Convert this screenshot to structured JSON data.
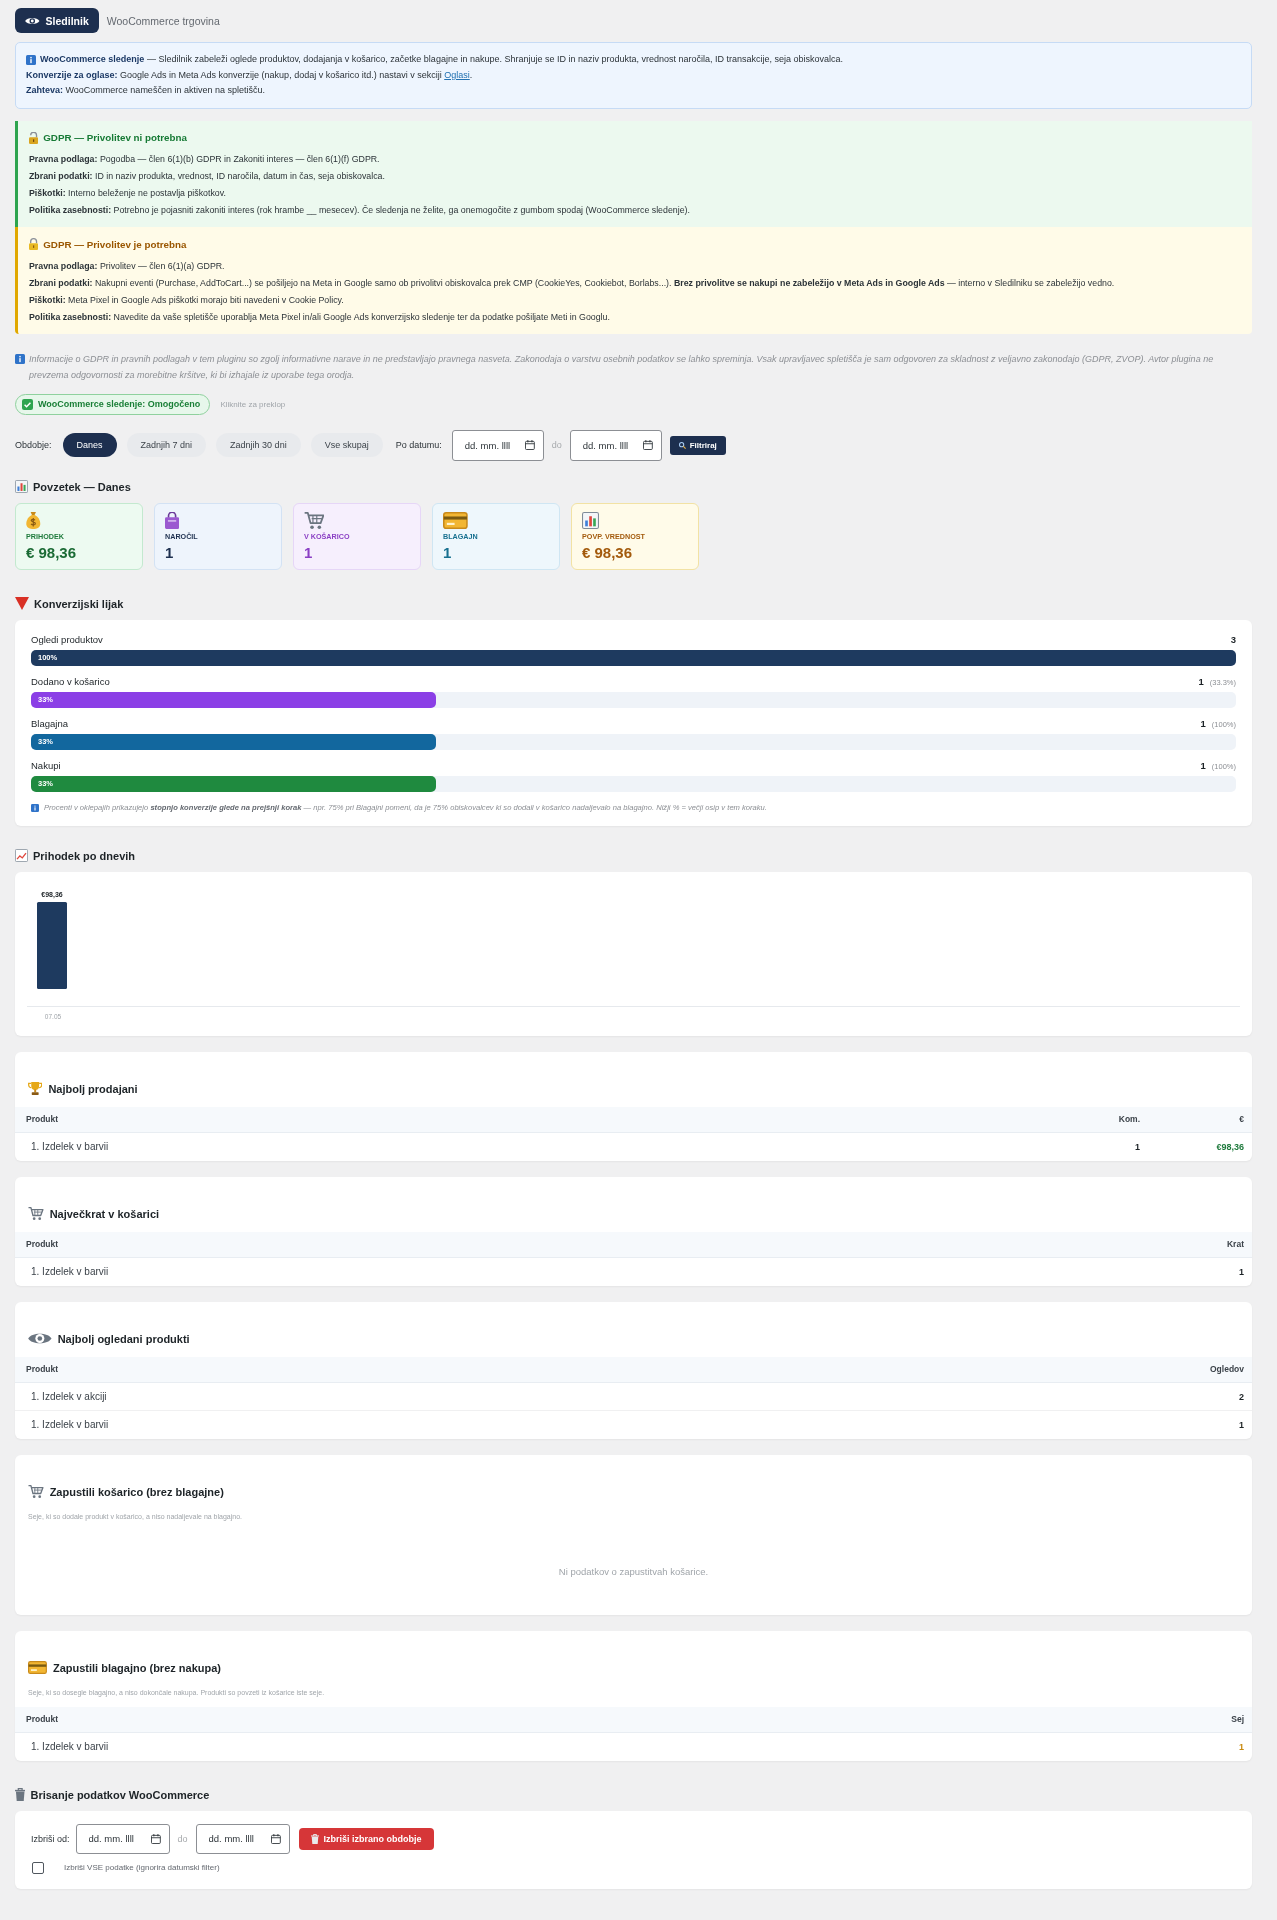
{
  "header": {
    "title": "Sledilnik",
    "subtitle": "WooCommerce trgovina"
  },
  "info_box": {
    "lines": [
      {
        "text": "**WooCommerce sledenje** — Sledilnik zabeleži oglede produktov, dodajanja v košarico, začetke blagajne in nakupe. Shranjuje se ID in naziv produkta, vrednost naročila, ID transakcije, seja obiskovalca."
      },
      {
        "text": "**Konverzije za oglase:** Google Ads in Meta Ads konverzije (nakup, dodaj v košarico itd.) nastavi v sekciji",
        "link": "Oglasi",
        "after": "."
      },
      {
        "text": "**Zahteva:** WooCommerce nameščen in aktiven na spletišču."
      }
    ]
  },
  "gdpr_notices": [
    {
      "kind": "lawful",
      "title": "GDPR — Privolitev ni potrebna",
      "lines": [
        "**Pravna podlaga:** Pogodba — člen 6(1)(b) GDPR in Zakoniti interes — člen 6(1)(f) GDPR.",
        "**Zbrani podatki:** ID in naziv produkta, vrednost, ID naročila, datum in čas, seja obiskovalca.",
        "**Piškotki:** Interno beleženje ne postavlja piškotkov.",
        "**Politika zasebnosti:** Potrebno je pojasniti zakoniti interes (rok hrambe __ mesecev). Če sledenja ne želite, ga onemogočite z gumbom spodaj (WooCommerce sledenje)."
      ]
    },
    {
      "kind": "consent",
      "title": "GDPR — Privolitev je potrebna",
      "lines": [
        "**Pravna podlaga:** Privolitev — člen 6(1)(a) GDPR.",
        "**Zbrani podatki:** Nakupni eventi (Purchase, AddToCart...) se pošiljejo na Meta in Google samo ob privolitvi obiskovalca prek CMP (CookieYes, Cookiebot, Borlabs...). **Brez privolitve se nakupi ne zabeležijo v Meta Ads in Google Ads** — interno v Sledilniku se zabeležijo vedno.",
        "**Piškotki:** Meta Pixel in Google Ads piškotki morajo biti navedeni v Cookie Policy.",
        "**Politika zasebnosti:** Navedite da vaše spletišče uporablja Meta Pixel in/ali Google Ads konverzijsko sledenje ter da podatke pošiljate Meti in Googlu."
      ]
    }
  ],
  "disclaimer": "Informacije o GDPR in pravnih podlagah v tem pluginu so zgolj informativne narave in ne predstavljajo pravnega nasveta. Zakonodaja o varstvu osebnih podatkov se lahko spreminja. Vsak upravljavec spletišča je sam odgovoren za skladnost z veljavno zakonodajo (GDPR, ZVOP). Avtor plugina ne prevzema odgovornosti za morebitne kršitve, ki bi izhajale iz uporabe tega orodja.",
  "tracking_toggle": {
    "label": "WooCommerce sledenje: Omogočeno",
    "on": true,
    "hint": "Kliknite za preklop"
  },
  "period_filter": {
    "label": "Obdobje:",
    "options": [
      {
        "label": "Danes",
        "selected": true
      },
      {
        "label": "Zadnjih 7 dni",
        "selected": false
      },
      {
        "label": "Zadnjih 30 dni",
        "selected": false
      },
      {
        "label": "Vse skupaj",
        "selected": false
      }
    ],
    "date_label": "Po datumu:",
    "date_from": {
      "placeholder": "dd. mm. llll"
    },
    "separator": "do",
    "date_to": {
      "placeholder": "dd. mm. llll"
    },
    "button": "Filtriraj"
  },
  "summary": {
    "title": "Povzetek — Danes",
    "cards": [
      {
        "kind": "revenue",
        "label": "PRIHODEK",
        "value": "€ 98,36"
      },
      {
        "kind": "orders",
        "label": "NAROČIL",
        "value": "1"
      },
      {
        "kind": "cart",
        "label": "V KOŠARICO",
        "value": "1"
      },
      {
        "kind": "checkout",
        "label": "BLAGAJN",
        "value": "1"
      },
      {
        "kind": "average",
        "label": "POVP. VREDNOST",
        "value": "€ 98,36"
      }
    ]
  },
  "funnel": {
    "title": "Konverzijski lijak",
    "steps": [
      {
        "label": "Ogledi produktov",
        "count": "3",
        "bar_label": "100%",
        "level": 1,
        "color": "#1e3a5f"
      },
      {
        "label": "Dodano v košarico",
        "count": "1",
        "rate": "(33.3%)",
        "bar_label": "33%",
        "level": 0.336,
        "color": "#8b3fe6"
      },
      {
        "label": "Blagajna",
        "count": "1",
        "rate": "(100%)",
        "bar_label": "33%",
        "level": 0.336,
        "color": "#12679e"
      },
      {
        "label": "Nakupi",
        "count": "1",
        "rate": "(100%)",
        "bar_label": "33%",
        "level": 0.336,
        "color": "#1f8a3f"
      }
    ],
    "note": "Procenti v oklepajih prikazujejo **stopnjo konverzije glede na prejšnji korak** — npr. 75% pri Blagajni pomeni, da je 75% obiskovalcev ki so dodali v košarico nadaljevalo na blagajno. Nižji % = večji osip v tem koraku."
  },
  "revenue_chart": {
    "title": "Prihodek po dnevih",
    "bars": [
      {
        "date": "07.05",
        "amount": "€98,36"
      }
    ]
  },
  "sections": [
    {
      "kind": "sales",
      "title": "Najbolj prodajani",
      "columns": [
        {
          "label": "Produkt",
          "kind": "name"
        },
        {
          "label": "Kom.",
          "kind": "count"
        },
        {
          "label": "€",
          "kind": "money"
        }
      ],
      "rows": [
        [
          "1. Izdelek v barvii",
          "1",
          "€98,36"
        ]
      ]
    },
    {
      "kind": "cart",
      "title": "Največkrat v košarici",
      "columns": [
        {
          "label": "Produkt",
          "kind": "name"
        },
        {
          "label": "Krat",
          "kind": "count"
        }
      ],
      "rows": [
        [
          "1. Izdelek v barvii",
          "1"
        ]
      ]
    },
    {
      "kind": "views",
      "title": "Najbolj ogledani produkti",
      "columns": [
        {
          "label": "Produkt",
          "kind": "name"
        },
        {
          "label": "Ogledov",
          "kind": "count"
        }
      ],
      "rows": [
        [
          "1. Izdelek v akciji",
          "2"
        ],
        [
          "1. Izdelek v barvii",
          "1"
        ]
      ]
    },
    {
      "kind": "abandoned",
      "title": "Zapustili košarico (brez blagajne)",
      "description": "Seje, ki so dodale produkt v košarico, a niso nadaljevale na blagajno.",
      "empty": "Ni podatkov o zapustitvah košarice."
    },
    {
      "kind": "checkout",
      "title": "Zapustili blagajno (brez nakupa)",
      "description": "Seje, ki so dosegle blagajno, a niso dokončale nakupa. Produkti so povzeti iz košarice iste seje.",
      "columns": [
        {
          "label": "Produkt",
          "kind": "name"
        },
        {
          "label": "Sej",
          "kind": "warning"
        }
      ],
      "rows": [
        [
          "1. Izdelek v barvii",
          "1"
        ]
      ]
    }
  ],
  "delete_data": {
    "title": "Brisanje podatkov WooCommerce",
    "from_label": "Izbriši od:",
    "date_from": {
      "placeholder": "dd. mm. llll"
    },
    "separator": "do",
    "date_to": {
      "placeholder": "dd. mm. llll"
    },
    "button": "Izbriši izbrano obdobje",
    "delete_all": {
      "label": "Izbriši VSE podatke (ignorira datumski filter)",
      "checked": false
    }
  }
}
